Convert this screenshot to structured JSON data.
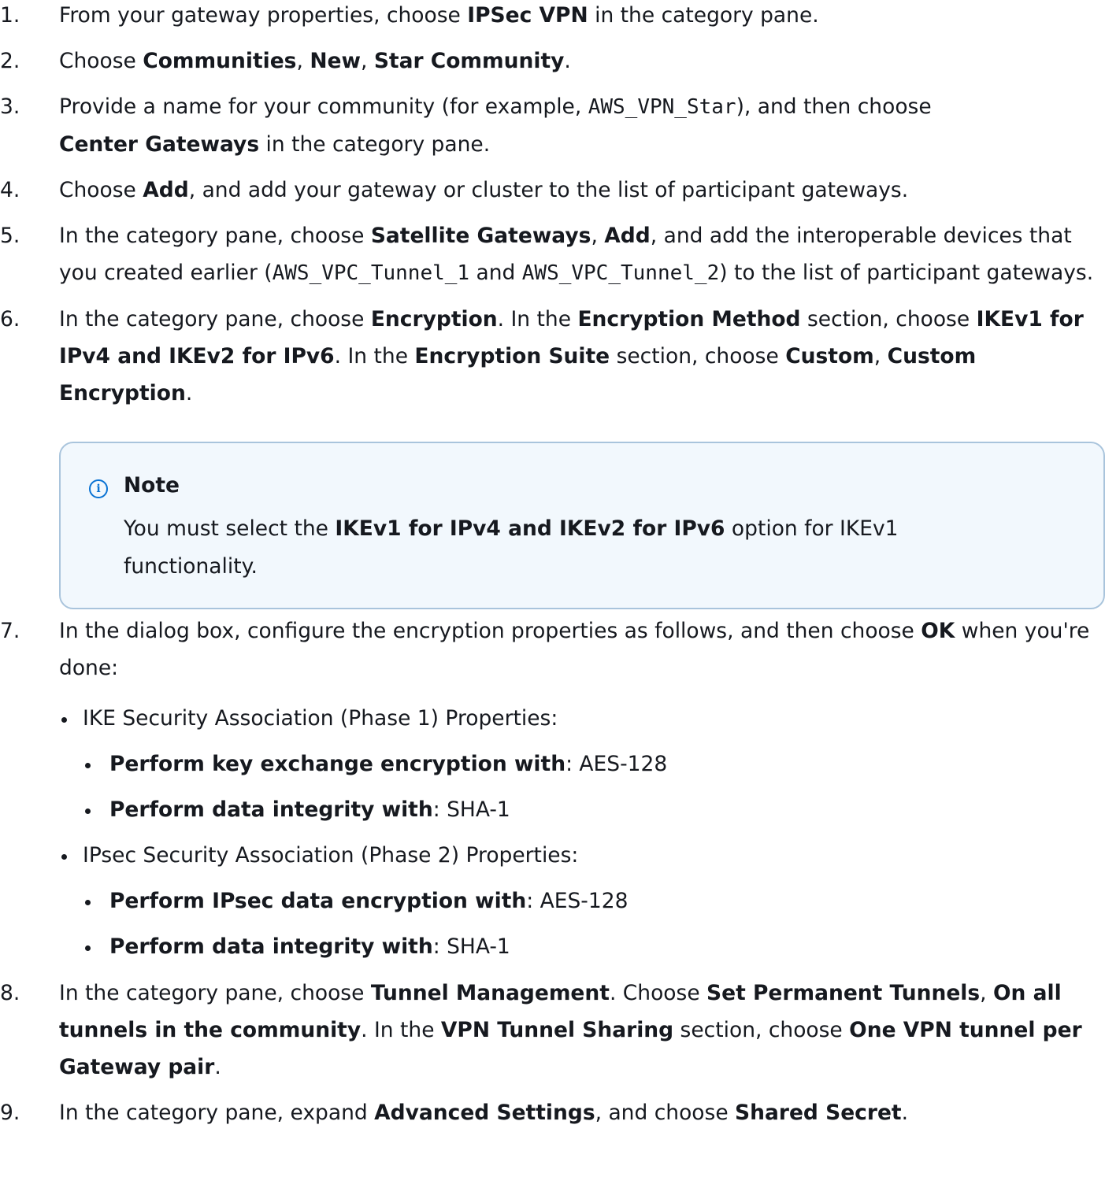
{
  "steps": [
    {
      "num": "1.",
      "parts": [
        "From your gateway properties, choose ",
        "IPSec VPN",
        " in the category pane."
      ]
    },
    {
      "num": "2.",
      "parts": [
        "Choose ",
        "Communities",
        ", ",
        "New",
        ", ",
        "Star Community",
        "."
      ]
    },
    {
      "num": "3.",
      "parts": [
        "Provide a name for your community (for example, ",
        "AWS_VPN_Star",
        "), and then choose ",
        "Center Gateways",
        " in the category pane."
      ]
    },
    {
      "num": "4.",
      "parts": [
        "Choose ",
        "Add",
        ", and add your gateway or cluster to the list of participant gateways."
      ]
    },
    {
      "num": "5.",
      "parts": [
        "In the category pane, choose ",
        "Satellite Gateways",
        ", ",
        "Add",
        ", and add the interoperable devices that you created earlier (",
        "AWS_VPC_Tunnel_1",
        " and ",
        "AWS_VPC_Tunnel_2",
        ") to the list of participant gateways."
      ]
    },
    {
      "num": "6.",
      "parts": [
        "In the category pane, choose ",
        "Encryption",
        ". In the ",
        "Encryption Method",
        " section, choose ",
        "IKEv1 for IPv4 and IKEv2 for IPv6",
        ". In the ",
        "Encryption Suite",
        " section, choose ",
        "Custom",
        ", ",
        "Custom Encryption",
        "."
      ]
    },
    {
      "num": "7.",
      "parts": [
        "In the dialog box, configure the encryption properties as follows, and then choose ",
        "OK",
        " when you're done:"
      ]
    },
    {
      "num": "8.",
      "parts": [
        "In the category pane, choose ",
        "Tunnel Management",
        ". Choose ",
        "Set Permanent Tunnels",
        ", ",
        "On all tunnels in the community",
        ". In the ",
        "VPN Tunnel Sharing",
        " section, choose ",
        "One VPN tunnel per Gateway pair",
        "."
      ]
    },
    {
      "num": "9.",
      "parts": [
        "In the category pane, expand ",
        "Advanced Settings",
        ", and choose ",
        "Shared Secret",
        "."
      ]
    }
  ],
  "note": {
    "title": "Note",
    "parts": [
      "You must select the ",
      "IKEv1 for IPv4 and IKEv2 for IPv6",
      " option for IKEv1 functionality."
    ]
  },
  "step7_list": {
    "phase1": {
      "label": "IKE Security Association (Phase 1) Properties:",
      "items": [
        {
          "key": "Perform key exchange encryption with",
          "value": ": AES-128"
        },
        {
          "key": "Perform data integrity with",
          "value": ": SHA-1"
        }
      ]
    },
    "phase2": {
      "label": "IPsec Security Association (Phase 2) Properties:",
      "items": [
        {
          "key": "Perform IPsec data encryption with",
          "value": ": AES-128"
        },
        {
          "key": "Perform data integrity with",
          "value": ": SHA-1"
        }
      ]
    }
  }
}
